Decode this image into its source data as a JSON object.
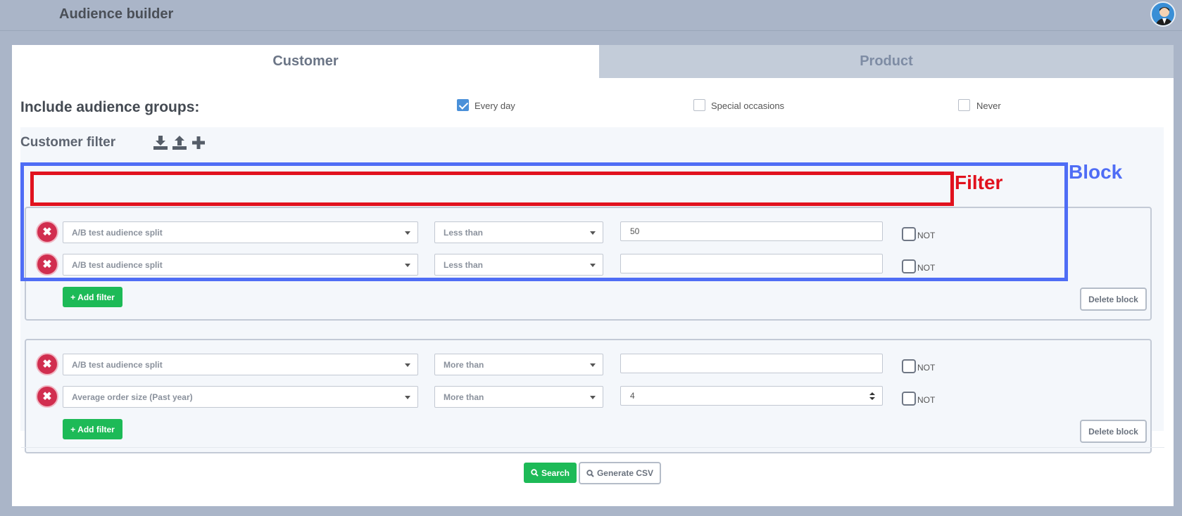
{
  "header": {
    "title": "Audience builder"
  },
  "tabs": [
    {
      "label": "Customer",
      "active": true
    },
    {
      "label": "Product",
      "active": false
    }
  ],
  "audience_groups": {
    "label": "Include audience groups:",
    "options": [
      {
        "label": "Every day",
        "checked": true
      },
      {
        "label": "Special occasions",
        "checked": false
      },
      {
        "label": "Never",
        "checked": false
      }
    ]
  },
  "customer_filter": {
    "title": "Customer filter",
    "icons": [
      "download-icon",
      "upload-icon",
      "plus-icon"
    ],
    "blocks": [
      {
        "filters": [
          {
            "field": "A/B test audience split",
            "operator": "Less than",
            "value": "50",
            "not_label": "NOT"
          },
          {
            "field": "A/B test audience split",
            "operator": "Less than",
            "value": "",
            "not_label": "NOT"
          }
        ],
        "add_filter_label": "Add filter",
        "delete_label": "Delete block"
      },
      {
        "filters": [
          {
            "field": "A/B test audience split",
            "operator": "More than",
            "value": "",
            "not_label": "NOT"
          },
          {
            "field": "Average order size (Past year)",
            "operator": "More than",
            "value": "4",
            "not_label": "NOT"
          }
        ],
        "add_filter_label": "Add filter",
        "delete_label": "Delete block"
      }
    ]
  },
  "actions": {
    "search_label": "Search",
    "csv_label": "Generate CSV"
  },
  "annotations": {
    "filter_label": "Filter",
    "block_label": "Block"
  },
  "colors": {
    "accent_green": "#1dba57",
    "remove_red": "#d12e4f",
    "annot_red": "#e1121e",
    "annot_blue": "#4f6df5",
    "check_blue": "#4a90d9"
  }
}
